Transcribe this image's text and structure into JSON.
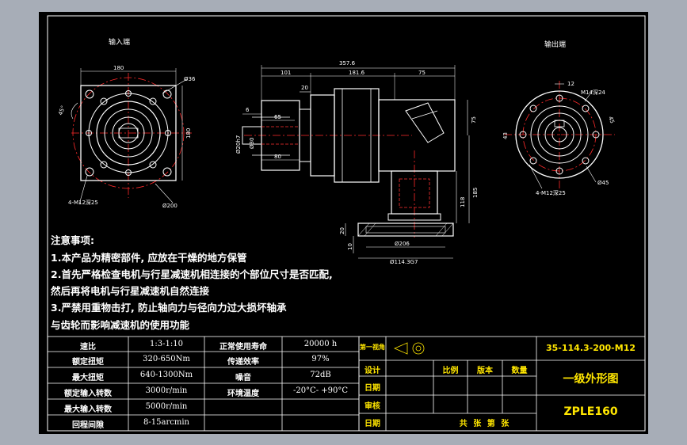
{
  "views": {
    "input_end_label": "输入端",
    "output_end_label": "输出端"
  },
  "dimensions": {
    "input": {
      "width": "180",
      "height": "180",
      "hole": "Ø36",
      "pcd": "Ø200",
      "angle": "45°",
      "bolts": "4-M12深25"
    },
    "side": {
      "overall": "357.6",
      "d101": "101",
      "d181": "181.6",
      "d75": "75",
      "d20": "20",
      "d6": "6",
      "d65": "65",
      "d80": "80",
      "bore": "Ø20h7",
      "bore2": "Ø30",
      "d75v": "75",
      "d118": "118",
      "d185": "185",
      "d10": "10",
      "d20b": "20",
      "base": "Ø206",
      "base2": "Ø114.3G7"
    },
    "output": {
      "d12": "12",
      "tap": "M14深24",
      "d43": "43",
      "d45": "45",
      "pcd": "Ø45",
      "bolts": "4-M12深25"
    }
  },
  "notes": {
    "title": "注意事项:",
    "items": [
      "1.本产品为精密部件, 应放在干燥的地方保管",
      "2.首先严格检查电机与行星减速机相连接的个部位尺寸是否匹配,",
      "然后再将电机与行星减速机自然连接",
      "3.严禁用重物击打, 防止轴向力与径向力过大损坏轴承",
      "与齿轮而影响减速机的使用功能"
    ]
  },
  "specs": {
    "rows": [
      {
        "label": "速比",
        "value": "1:3-1:10",
        "label2": "正常使用寿命",
        "value2": "20000 h"
      },
      {
        "label": "额定扭矩",
        "value": "320-650Nm",
        "label2": "传递效率",
        "value2": "97%"
      },
      {
        "label": "最大扭矩",
        "value": "640-1300Nm",
        "label2": "噪音",
        "value2": "72dB"
      },
      {
        "label": "额定输入转数",
        "value": "3000r/min",
        "label2": "环境温度",
        "value2": "-20°C- +90°C"
      },
      {
        "label": "最大输入转数",
        "value": "5000r/min",
        "label2": "",
        "value2": ""
      },
      {
        "label": "回程间隙",
        "value": "8-15arcmin",
        "label2": "",
        "value2": ""
      }
    ]
  },
  "title_block": {
    "projection_label": "第一视角",
    "design": "设计",
    "date1": "日期",
    "review": "审核",
    "date2": "日期",
    "scale": "比例",
    "version": "版本",
    "quantity": "数量",
    "sheets": "共  张  第  张",
    "drawing_no": "35-114.3-200-M12",
    "drawing_title": "一级外形图",
    "model": "ZPLE160"
  },
  "colors": {
    "outline": "#ffffff",
    "centerline": "#ff2a2a",
    "hidden": "#ff3030",
    "title_text": "#ffe600",
    "sheet": "#000000",
    "margin": "#a7adb7"
  }
}
